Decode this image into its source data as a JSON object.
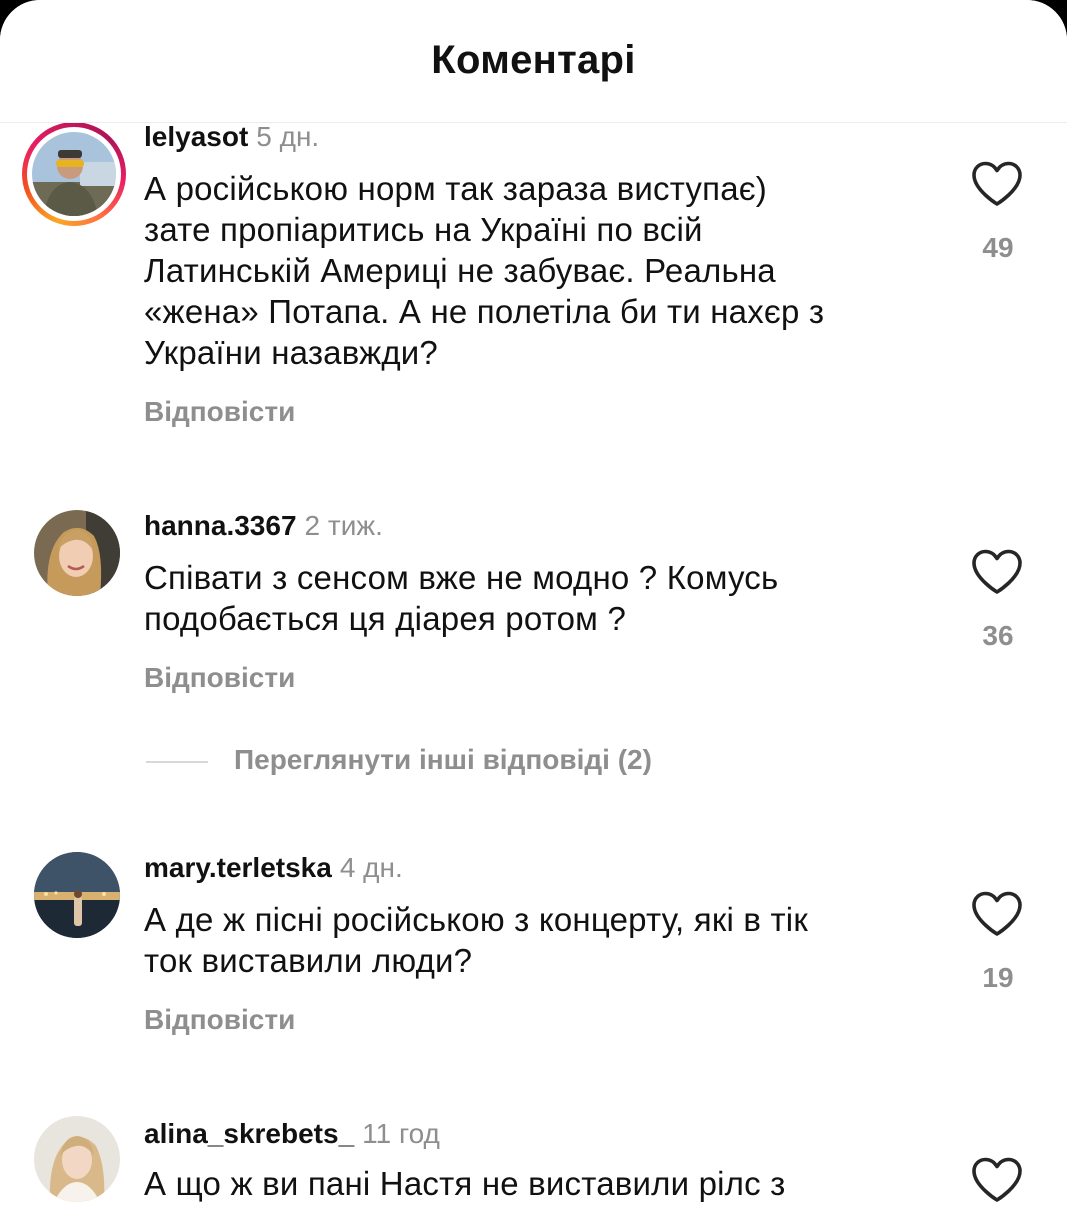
{
  "header": {
    "title": "Коментарі"
  },
  "comments": [
    {
      "username": "lelyasot",
      "time": "5 дн.",
      "text": "А російською норм так зараза виступає)\nзате пропіаритись на Україні по всій\nЛатинській Америці не забуває. Реальна\n«жена» Потапа. А не полетіла би ти нахєр з\nУкраїни назавжди?",
      "reply_label": "Відповісти",
      "likes": "49",
      "has_story_ring": true
    },
    {
      "username": "hanna.3367",
      "time": "2 тиж.",
      "text": "Співати з сенсом вже не модно ? Комусь\nподобається ця діарея ротом ?",
      "reply_label": "Відповісти",
      "likes": "36",
      "has_story_ring": false
    },
    {
      "username": "mary.terletska",
      "time": "4 дн.",
      "text": "А де ж пісні російською з концерту, які в тік\nток виставили люди?",
      "reply_label": "Відповісти",
      "likes": "19",
      "has_story_ring": false
    },
    {
      "username": "alina_skrebets_",
      "time": "11 год",
      "text": "А що ж ви пані Настя не виставили рілс з",
      "has_story_ring": false
    }
  ],
  "view_more_replies": "Переглянути інші відповіді (2)",
  "colors": {
    "text": "#111111",
    "secondary": "#8e8e8e",
    "divider": "#ececec",
    "story_ring": [
      "#f9a825",
      "#e91e63",
      "#c2185b"
    ]
  },
  "icons": {
    "like": "heart-outline-icon"
  }
}
